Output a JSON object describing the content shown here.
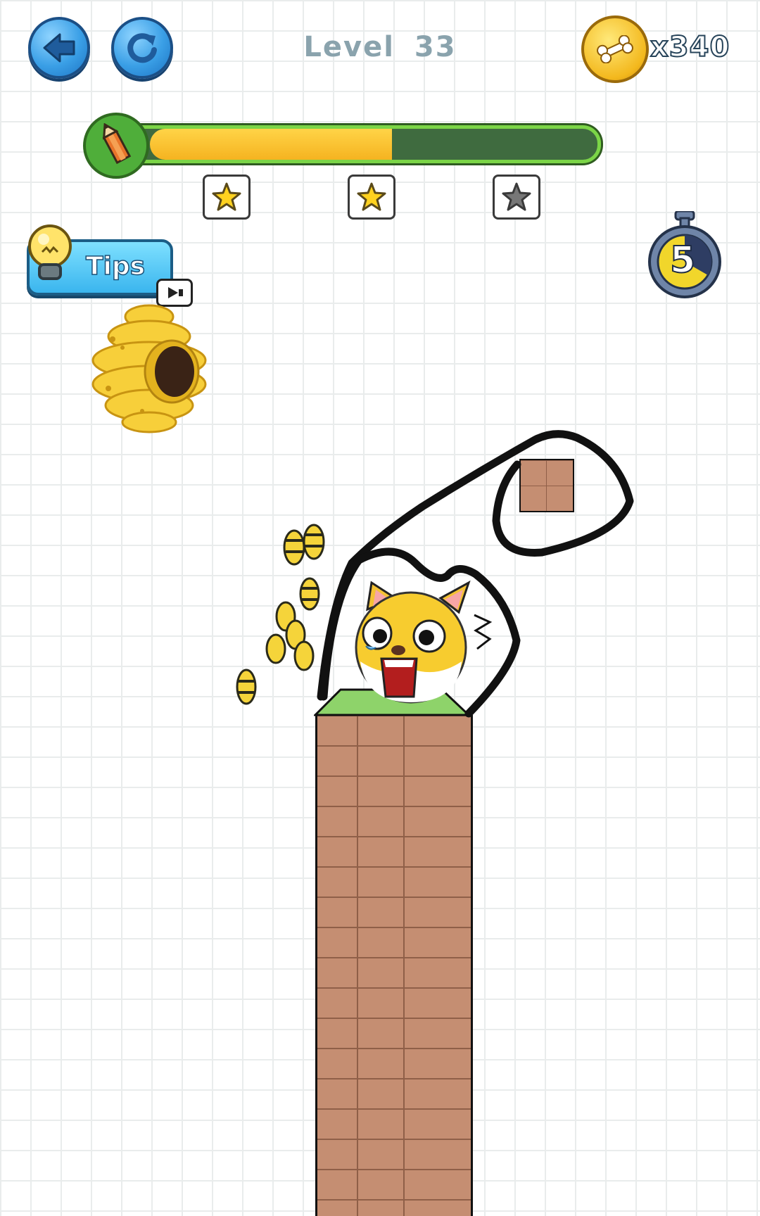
{
  "header": {
    "level_label": "Level",
    "level_number": "33",
    "coin_count": "x340"
  },
  "progress": {
    "fraction": 0.55,
    "stars": [
      {
        "earned": true
      },
      {
        "earned": true
      },
      {
        "earned": false
      }
    ]
  },
  "tips": {
    "label": "Tips"
  },
  "timer": {
    "seconds": "5"
  },
  "colors": {
    "button_blue": "#3a9fe6",
    "progress_fill": "#f5b320",
    "progress_border": "#7bd547",
    "brick": "#c58e72",
    "grass": "#8ed36a"
  },
  "icons": {
    "back": "back-arrow-icon",
    "restart": "restart-icon",
    "coin": "bone-coin-icon",
    "pencil": "pencil-icon",
    "lightbulb": "lightbulb-icon",
    "video": "video-ad-icon",
    "stopwatch": "stopwatch-icon"
  }
}
